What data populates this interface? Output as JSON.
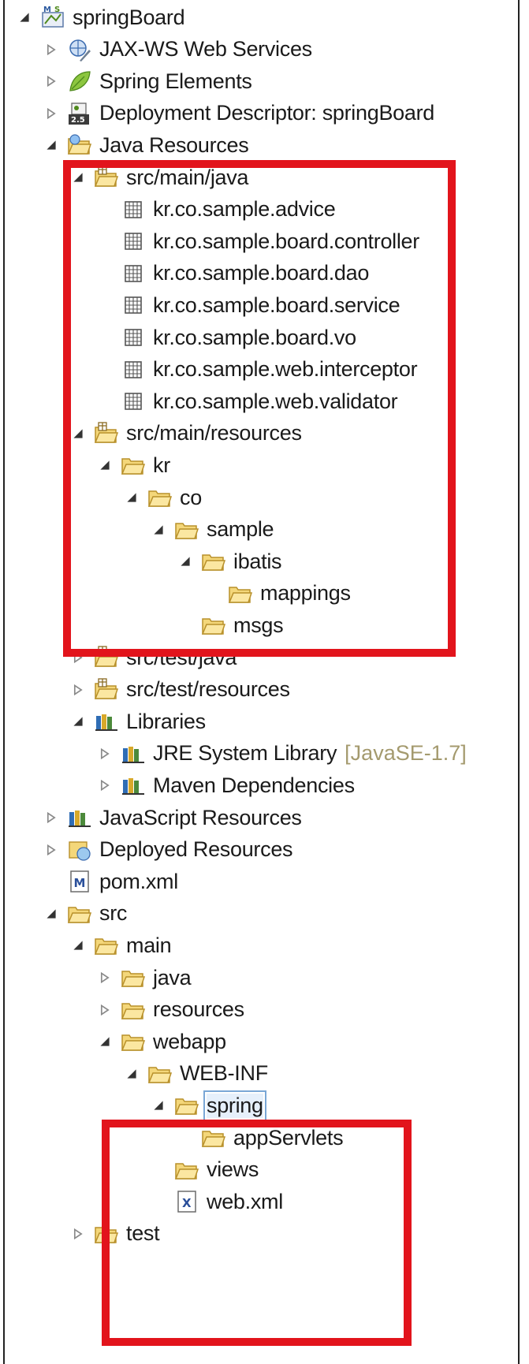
{
  "colors": {
    "highlight": "#e2141c",
    "folder": "#e8c057",
    "package": "#555555",
    "extra_label": "#a49a6e"
  },
  "tree": [
    {
      "label": "springBoard",
      "level": 0,
      "twisty": "expanded",
      "icon": "spring-project-icon"
    },
    {
      "label": "JAX-WS Web Services",
      "level": 1,
      "twisty": "collapsed",
      "icon": "web-services-icon"
    },
    {
      "label": "Spring Elements",
      "level": 1,
      "twisty": "collapsed",
      "icon": "spring-leaf-icon"
    },
    {
      "label": "Deployment Descriptor: springBoard",
      "level": 1,
      "twisty": "collapsed",
      "icon": "deployment-descriptor-icon"
    },
    {
      "label": "Java Resources",
      "level": 1,
      "twisty": "expanded",
      "icon": "java-resources-icon"
    },
    {
      "label": "src/main/java",
      "level": 2,
      "twisty": "expanded",
      "icon": "source-folder-icon"
    },
    {
      "label": "kr.co.sample.advice",
      "level": 3,
      "twisty": "none",
      "icon": "package-icon"
    },
    {
      "label": "kr.co.sample.board.controller",
      "level": 3,
      "twisty": "none",
      "icon": "package-icon"
    },
    {
      "label": "kr.co.sample.board.dao",
      "level": 3,
      "twisty": "none",
      "icon": "package-icon"
    },
    {
      "label": "kr.co.sample.board.service",
      "level": 3,
      "twisty": "none",
      "icon": "package-icon"
    },
    {
      "label": "kr.co.sample.board.vo",
      "level": 3,
      "twisty": "none",
      "icon": "package-icon"
    },
    {
      "label": "kr.co.sample.web.interceptor",
      "level": 3,
      "twisty": "none",
      "icon": "package-icon"
    },
    {
      "label": "kr.co.sample.web.validator",
      "level": 3,
      "twisty": "none",
      "icon": "package-icon"
    },
    {
      "label": "src/main/resources",
      "level": 2,
      "twisty": "expanded",
      "icon": "source-folder-icon"
    },
    {
      "label": "kr",
      "level": 3,
      "twisty": "expanded",
      "icon": "folder-icon"
    },
    {
      "label": "co",
      "level": 4,
      "twisty": "expanded",
      "icon": "folder-icon"
    },
    {
      "label": "sample",
      "level": 5,
      "twisty": "expanded",
      "icon": "folder-icon"
    },
    {
      "label": "ibatis",
      "level": 6,
      "twisty": "expanded",
      "icon": "folder-icon"
    },
    {
      "label": "mappings",
      "level": 7,
      "twisty": "none",
      "icon": "folder-icon"
    },
    {
      "label": "msgs",
      "level": 6,
      "twisty": "none",
      "icon": "folder-icon"
    },
    {
      "label": "src/test/java",
      "level": 2,
      "twisty": "collapsed",
      "icon": "source-folder-icon"
    },
    {
      "label": "src/test/resources",
      "level": 2,
      "twisty": "collapsed",
      "icon": "source-folder-icon"
    },
    {
      "label": "Libraries",
      "level": 2,
      "twisty": "expanded",
      "icon": "library-icon"
    },
    {
      "label": "JRE System Library",
      "extra": "[JavaSE-1.7]",
      "level": 3,
      "twisty": "collapsed",
      "icon": "library-icon"
    },
    {
      "label": "Maven Dependencies",
      "level": 3,
      "twisty": "collapsed",
      "icon": "library-icon"
    },
    {
      "label": "JavaScript Resources",
      "level": 1,
      "twisty": "collapsed",
      "icon": "library-icon"
    },
    {
      "label": "Deployed Resources",
      "level": 1,
      "twisty": "collapsed",
      "icon": "deployed-resources-icon"
    },
    {
      "label": "pom.xml",
      "level": 1,
      "twisty": "none",
      "icon": "maven-file-icon"
    },
    {
      "label": "src",
      "level": 1,
      "twisty": "expanded",
      "icon": "folder-icon"
    },
    {
      "label": "main",
      "level": 2,
      "twisty": "expanded",
      "icon": "folder-icon"
    },
    {
      "label": "java",
      "level": 3,
      "twisty": "collapsed",
      "icon": "folder-icon"
    },
    {
      "label": "resources",
      "level": 3,
      "twisty": "collapsed",
      "icon": "folder-icon"
    },
    {
      "label": "webapp",
      "level": 3,
      "twisty": "expanded",
      "icon": "folder-icon"
    },
    {
      "label": "WEB-INF",
      "level": 4,
      "twisty": "expanded",
      "icon": "folder-icon"
    },
    {
      "label": "spring",
      "level": 5,
      "twisty": "expanded",
      "icon": "folder-icon",
      "selected": true
    },
    {
      "label": "appServlets",
      "level": 6,
      "twisty": "none",
      "icon": "folder-icon"
    },
    {
      "label": "views",
      "level": 5,
      "twisty": "none",
      "icon": "folder-icon"
    },
    {
      "label": "web.xml",
      "level": 5,
      "twisty": "none",
      "icon": "xml-file-icon"
    },
    {
      "label": "test",
      "level": 2,
      "twisty": "collapsed",
      "icon": "folder-icon"
    }
  ]
}
